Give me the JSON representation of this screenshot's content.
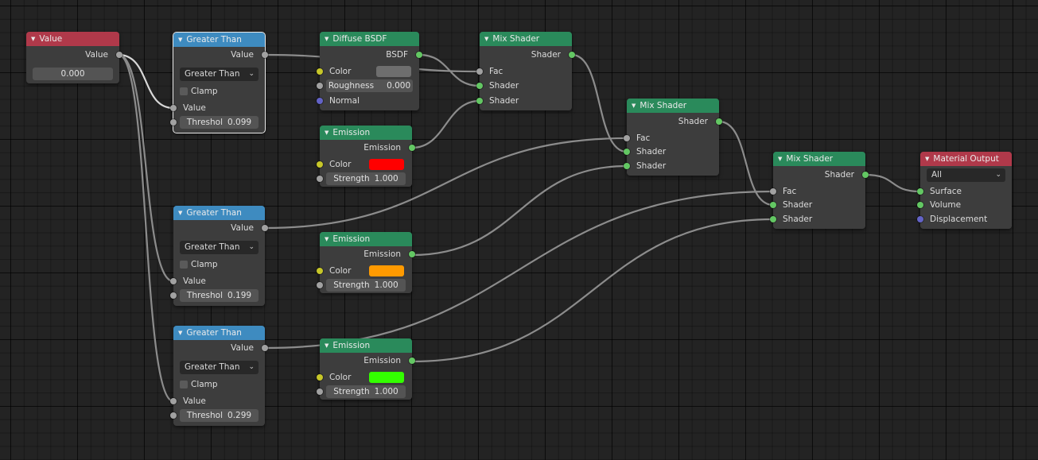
{
  "app": "Blender Shader Editor",
  "colors": {
    "input_header": "#b0394a",
    "converter_header": "#3e8bc0",
    "shader_header": "#2a8a5b",
    "output_header": "#b0394a",
    "socket_float": "#a1a1a1",
    "socket_shader": "#63c763",
    "socket_color": "#c7c729",
    "socket_vector": "#6363c7"
  },
  "nodes": {
    "value": {
      "title": "Value",
      "output": "Value",
      "value": "0.000"
    },
    "gt1": {
      "title": "Greater Than",
      "output": "Value",
      "operation": "Greater Than",
      "clamp_label": "Clamp",
      "clamp": false,
      "input": "Value",
      "threshold_label": "Threshol",
      "threshold": "0.099",
      "selected": true
    },
    "gt2": {
      "title": "Greater Than",
      "output": "Value",
      "operation": "Greater Than",
      "clamp_label": "Clamp",
      "clamp": false,
      "input": "Value",
      "threshold_label": "Threshol",
      "threshold": "0.199"
    },
    "gt3": {
      "title": "Greater Than",
      "output": "Value",
      "operation": "Greater Than",
      "clamp_label": "Clamp",
      "clamp": false,
      "input": "Value",
      "threshold_label": "Threshol",
      "threshold": "0.299"
    },
    "diffuse": {
      "title": "Diffuse BSDF",
      "output": "BSDF",
      "color_label": "Color",
      "color": "#6e6e6e",
      "roughness_label": "Roughness",
      "roughness": "0.000",
      "normal_label": "Normal"
    },
    "em1": {
      "title": "Emission",
      "output": "Emission",
      "color_label": "Color",
      "color": "#ff0000",
      "strength_label": "Strength",
      "strength": "1.000"
    },
    "em2": {
      "title": "Emission",
      "output": "Emission",
      "color_label": "Color",
      "color": "#ff9a00",
      "strength_label": "Strength",
      "strength": "1.000"
    },
    "em3": {
      "title": "Emission",
      "output": "Emission",
      "color_label": "Color",
      "color": "#33ff00",
      "strength_label": "Strength",
      "strength": "1.000"
    },
    "mix1": {
      "title": "Mix Shader",
      "output": "Shader",
      "fac": "Fac",
      "shader_a": "Shader",
      "shader_b": "Shader"
    },
    "mix2": {
      "title": "Mix Shader",
      "output": "Shader",
      "fac": "Fac",
      "shader_a": "Shader",
      "shader_b": "Shader"
    },
    "mix3": {
      "title": "Mix Shader",
      "output": "Shader",
      "fac": "Fac",
      "shader_a": "Shader",
      "shader_b": "Shader"
    },
    "matout": {
      "title": "Material Output",
      "target": "All",
      "surface": "Surface",
      "volume": "Volume",
      "displacement": "Displacement"
    }
  },
  "links": [
    [
      "value.Value",
      "gt1.Value"
    ],
    [
      "value.Value",
      "gt2.Value"
    ],
    [
      "value.Value",
      "gt3.Value"
    ],
    [
      "gt1.Value",
      "mix1.Fac"
    ],
    [
      "diffuse.BSDF",
      "mix1.Shader"
    ],
    [
      "em1.Emission",
      "mix1.Shader_2"
    ],
    [
      "gt2.Value",
      "mix2.Fac"
    ],
    [
      "mix1.Shader",
      "mix2.Shader"
    ],
    [
      "em2.Emission",
      "mix2.Shader_2"
    ],
    [
      "gt3.Value",
      "mix3.Fac"
    ],
    [
      "mix2.Shader",
      "mix3.Shader"
    ],
    [
      "em3.Emission",
      "mix3.Shader_2"
    ],
    [
      "mix3.Shader",
      "matout.Surface"
    ]
  ]
}
